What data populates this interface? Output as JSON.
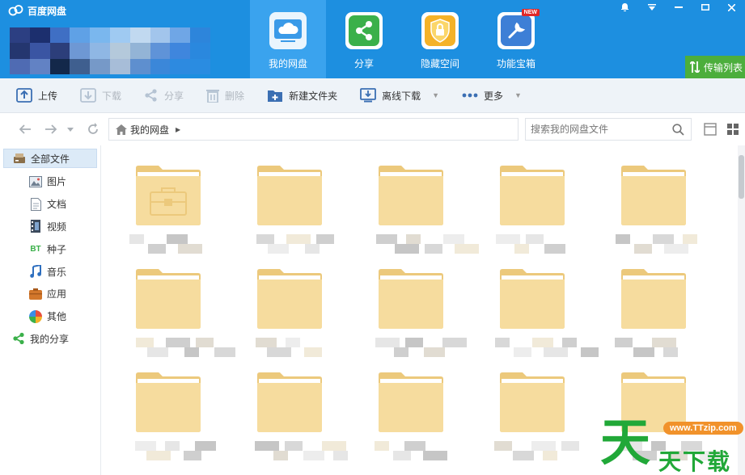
{
  "app": {
    "title": "百度网盘"
  },
  "nav": [
    {
      "label": "我的网盘",
      "icon": "cloud-icon"
    },
    {
      "label": "分享",
      "icon": "share-icon"
    },
    {
      "label": "隐藏空间",
      "icon": "lock-shield-icon"
    },
    {
      "label": "功能宝箱",
      "icon": "toolbox-icon",
      "badge": "NEW"
    }
  ],
  "transfer": {
    "label": "传输列表"
  },
  "toolbar": {
    "upload": "上传",
    "download": "下载",
    "share": "分享",
    "delete": "删除",
    "new_folder": "新建文件夹",
    "offline_download": "离线下载",
    "more": "更多"
  },
  "address": {
    "crumb": "我的网盘",
    "search_placeholder": "搜索我的网盘文件"
  },
  "sidebar": {
    "items": [
      {
        "label": "全部文件",
        "icon": "drive-icon"
      },
      {
        "label": "图片",
        "icon": "image-icon"
      },
      {
        "label": "文档",
        "icon": "document-icon"
      },
      {
        "label": "视频",
        "icon": "video-icon"
      },
      {
        "label": "种子",
        "icon": "bt-icon",
        "icon_text": "BT"
      },
      {
        "label": "音乐",
        "icon": "music-icon"
      },
      {
        "label": "应用",
        "icon": "app-icon"
      },
      {
        "label": "其他",
        "icon": "other-icon"
      },
      {
        "label": "我的分享",
        "icon": "share-icon"
      }
    ]
  },
  "watermark": {
    "big": "天",
    "url": "www.TTzip.com",
    "text": "天下载"
  },
  "colors": {
    "header": "#1d8fe0",
    "nav_active": "#3aa3ee",
    "transfer": "#4cae3c",
    "folder": "#f6dc9e",
    "folder_dark": "#ecc97c",
    "watermark": "#21a838"
  }
}
